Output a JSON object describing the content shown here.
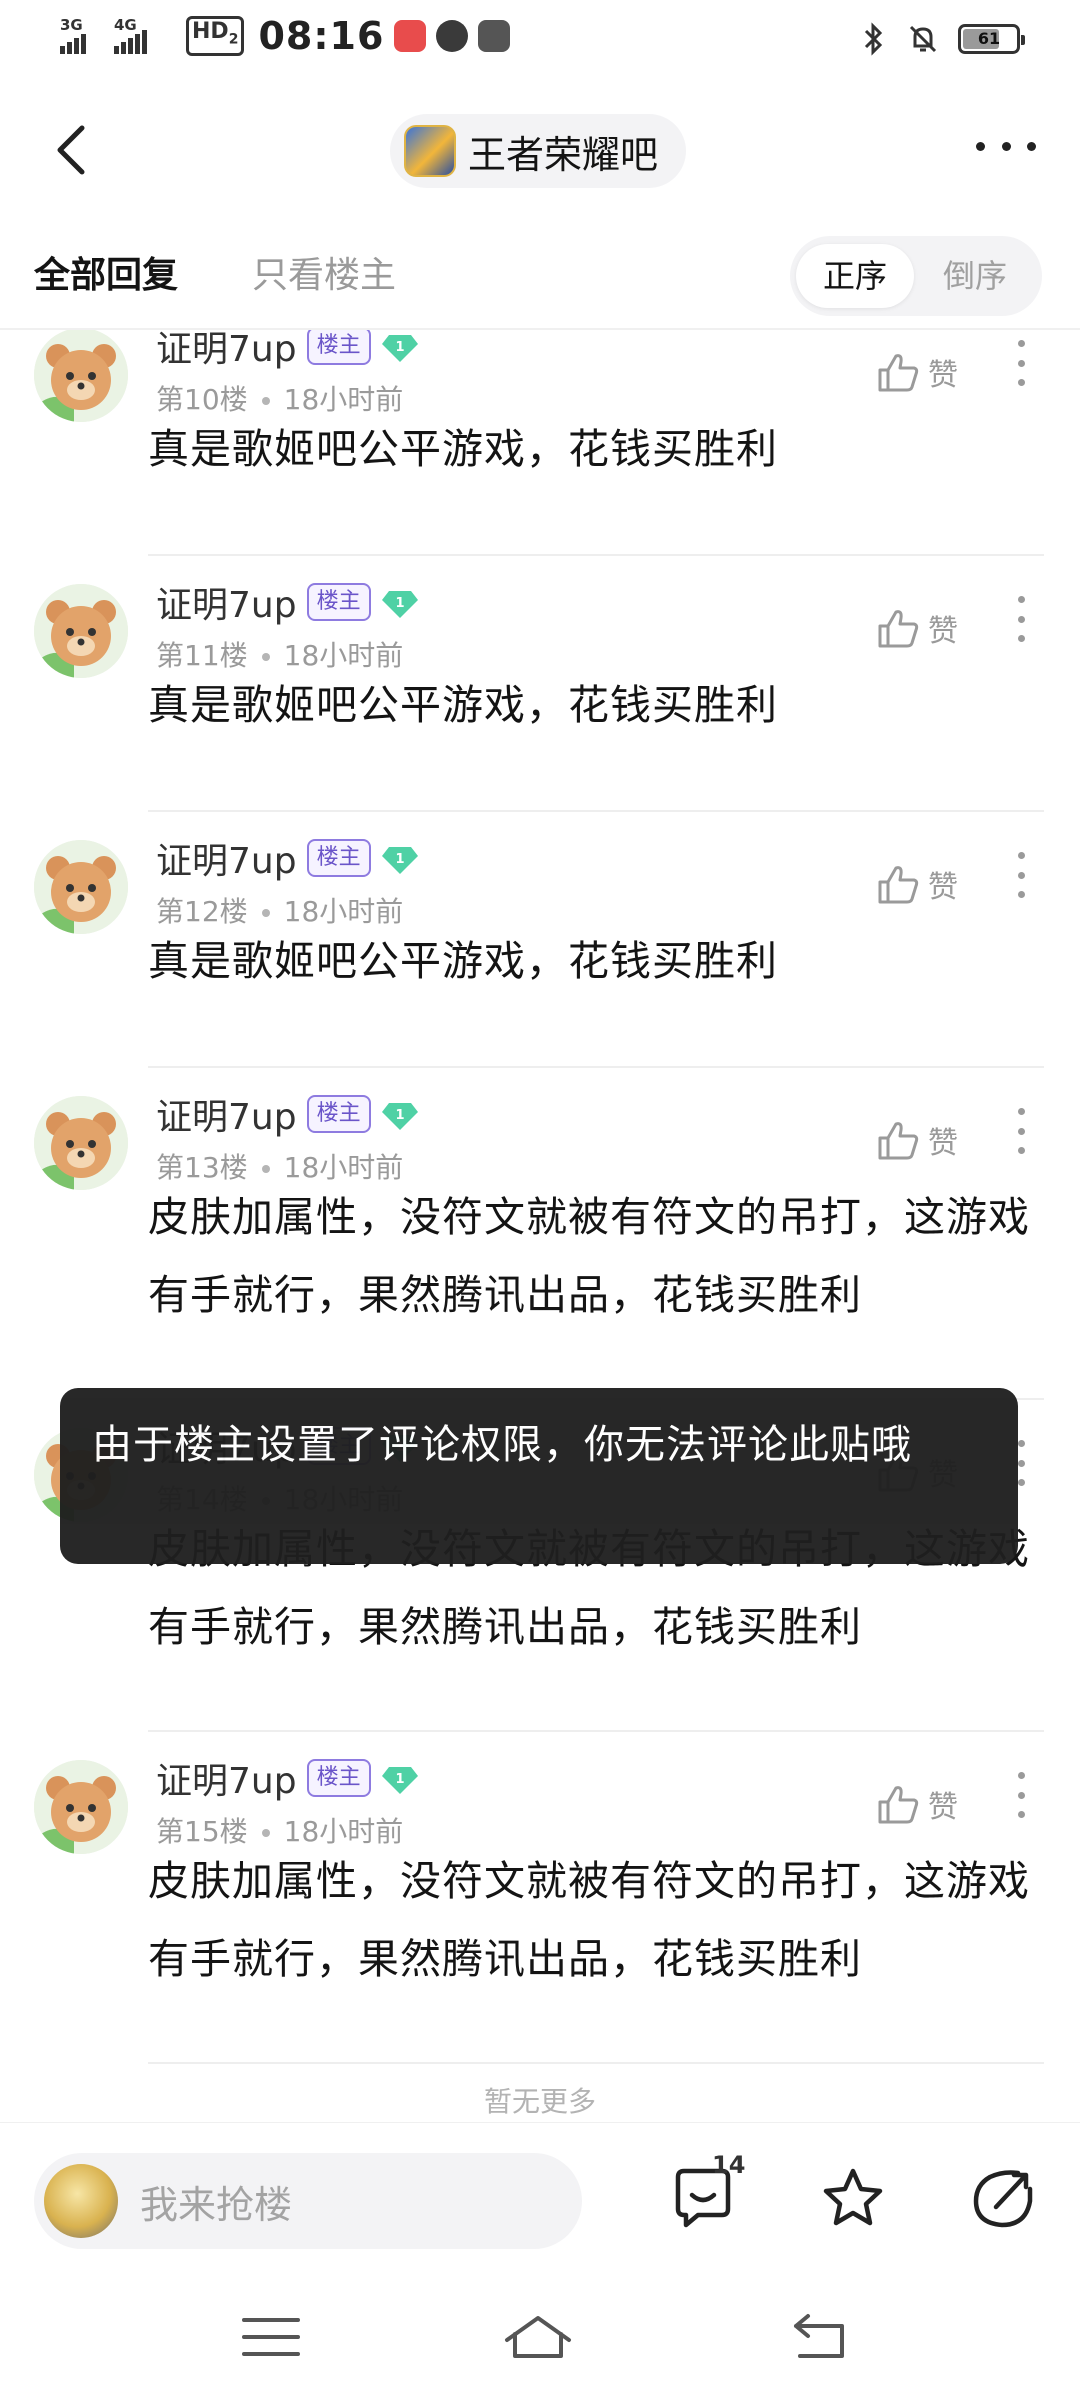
{
  "status_bar": {
    "network_left": "3G",
    "network_right": "4G",
    "hd_label": "HD",
    "hd_sub": "2",
    "time": "08:16",
    "battery": "61"
  },
  "header": {
    "forum_name": "王者荣耀吧"
  },
  "tabs": {
    "all_replies": "全部回复",
    "host_only": "只看楼主",
    "order_asc": "正序",
    "order_desc": "倒序"
  },
  "posts": [
    {
      "username": "证明7up",
      "badge": "楼主",
      "level": "1",
      "floor": "第10楼",
      "time": "18小时前",
      "like_label": "赞",
      "content": "真是歌姬吧公平游戏，花钱买胜利"
    },
    {
      "username": "证明7up",
      "badge": "楼主",
      "level": "1",
      "floor": "第11楼",
      "time": "18小时前",
      "like_label": "赞",
      "content": "真是歌姬吧公平游戏，花钱买胜利"
    },
    {
      "username": "证明7up",
      "badge": "楼主",
      "level": "1",
      "floor": "第12楼",
      "time": "18小时前",
      "like_label": "赞",
      "content": "真是歌姬吧公平游戏，花钱买胜利"
    },
    {
      "username": "证明7up",
      "badge": "楼主",
      "level": "1",
      "floor": "第13楼",
      "time": "18小时前",
      "like_label": "赞",
      "content": "皮肤加属性，没符文就被有符文的吊打，这游戏有手就行，果然腾讯出品，花钱买胜利"
    },
    {
      "username": "证明7up",
      "badge": "楼主",
      "level": "1",
      "floor": "第14楼",
      "time": "18小时前",
      "like_label": "赞",
      "content": "皮肤加属性，没符文就被有符文的吊打，这游戏有手就行，果然腾讯出品，花钱买胜利"
    },
    {
      "username": "证明7up",
      "badge": "楼主",
      "level": "1",
      "floor": "第15楼",
      "time": "18小时前",
      "like_label": "赞",
      "content": "皮肤加属性，没符文就被有符文的吊打，这游戏有手就行，果然腾讯出品，花钱买胜利"
    }
  ],
  "feed_end": "暂无更多",
  "toast": "由于楼主设置了评论权限，你无法评论此贴哦",
  "bottom_bar": {
    "reply_placeholder": "我来抢楼",
    "comment_count": "14"
  },
  "colors": {
    "accent_purple": "#6a55c9",
    "level_green": "#4fd1a5",
    "text_primary": "#141414",
    "text_secondary": "#9a9a9a"
  }
}
